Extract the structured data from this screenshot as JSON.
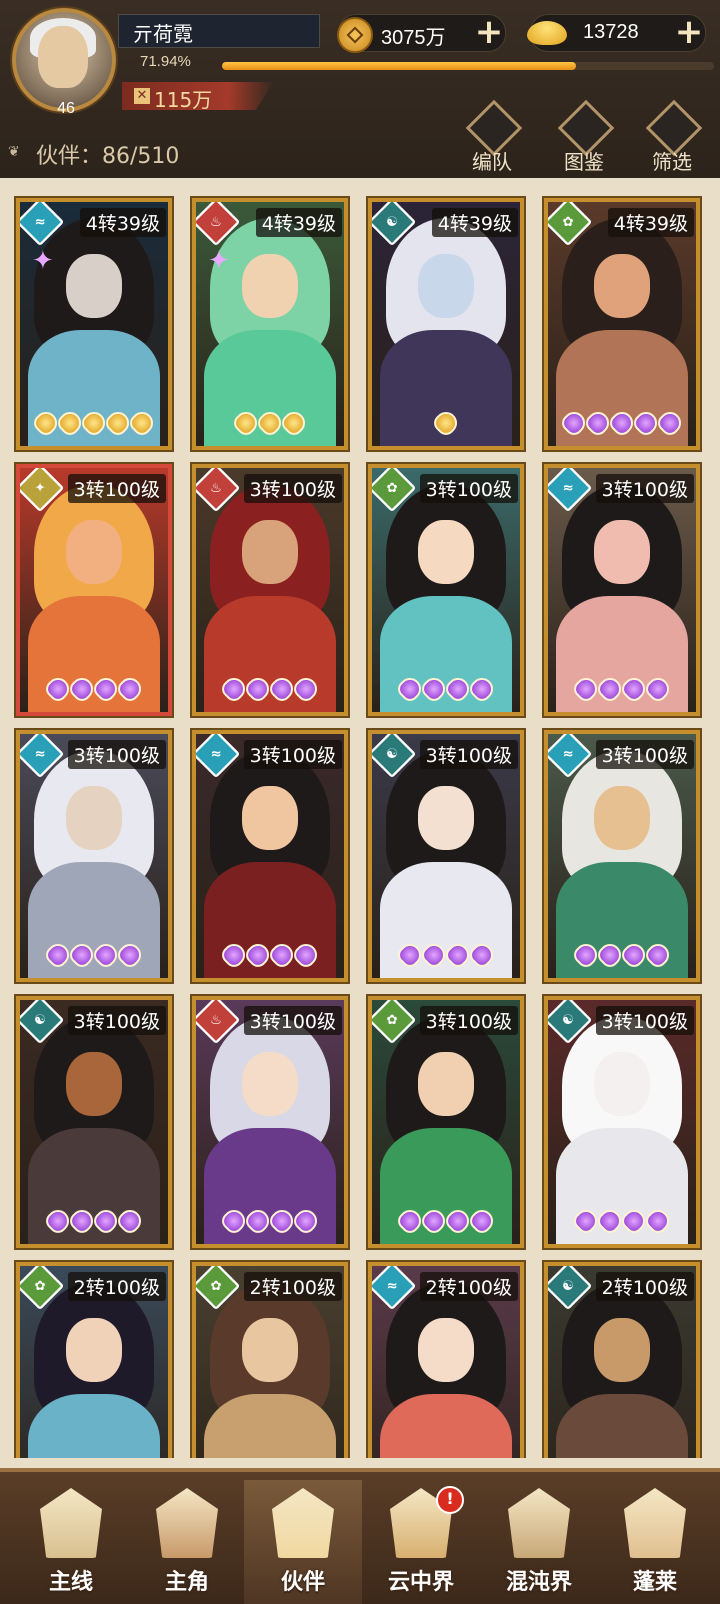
{
  "player": {
    "name": "亓荷霓",
    "level": "46",
    "exp_pct": "71.94%",
    "exp_fraction": 0.7194,
    "power": "115万"
  },
  "resources": {
    "coins": "3075万",
    "ingots": "13728"
  },
  "partners": {
    "label": "伙伴：86/510"
  },
  "toolbar": {
    "team": "编队",
    "codex": "图鉴",
    "filter": "筛选"
  },
  "cards": [
    {
      "tier": "4转39级",
      "element": "water",
      "stars": 5,
      "star_color": "gold",
      "sparkle": true
    },
    {
      "tier": "4转39级",
      "element": "fire",
      "stars": 3,
      "star_color": "gold",
      "sparkle": true
    },
    {
      "tier": "4转39级",
      "element": "dark",
      "stars": 1,
      "star_color": "gold",
      "sparkle": false
    },
    {
      "tier": "4转39级",
      "element": "wood",
      "stars": 5,
      "star_color": "purple",
      "sparkle": false
    },
    {
      "tier": "3转100级",
      "element": "earth",
      "stars": 4,
      "star_color": "purple",
      "sparkle": false
    },
    {
      "tier": "3转100级",
      "element": "fire",
      "stars": 4,
      "star_color": "purple",
      "sparkle": false
    },
    {
      "tier": "3转100级",
      "element": "wood",
      "stars": 4,
      "star_color": "purple",
      "sparkle": false
    },
    {
      "tier": "3转100级",
      "element": "water",
      "stars": 4,
      "star_color": "purple",
      "sparkle": false
    },
    {
      "tier": "3转100级",
      "element": "water",
      "stars": 4,
      "star_color": "purple",
      "sparkle": false
    },
    {
      "tier": "3转100级",
      "element": "water",
      "stars": 4,
      "star_color": "purple",
      "sparkle": false
    },
    {
      "tier": "3转100级",
      "element": "dark",
      "stars": 4,
      "star_color": "purple",
      "sparkle": false
    },
    {
      "tier": "3转100级",
      "element": "water",
      "stars": 4,
      "star_color": "purple",
      "sparkle": false
    },
    {
      "tier": "3转100级",
      "element": "dark",
      "stars": 4,
      "star_color": "purple",
      "sparkle": false
    },
    {
      "tier": "3转100级",
      "element": "fire",
      "stars": 4,
      "star_color": "purple",
      "sparkle": false
    },
    {
      "tier": "3转100级",
      "element": "wood",
      "stars": 4,
      "star_color": "purple",
      "sparkle": false
    },
    {
      "tier": "3转100级",
      "element": "dark",
      "stars": 4,
      "star_color": "purple",
      "sparkle": false
    },
    {
      "tier": "2转100级",
      "element": "wood",
      "stars": 0,
      "star_color": "purple",
      "sparkle": false
    },
    {
      "tier": "2转100级",
      "element": "wood",
      "stars": 0,
      "star_color": "purple",
      "sparkle": false
    },
    {
      "tier": "2转100级",
      "element": "water",
      "stars": 0,
      "star_color": "purple",
      "sparkle": false
    },
    {
      "tier": "2转100级",
      "element": "dark",
      "stars": 0,
      "star_color": "purple",
      "sparkle": false
    }
  ],
  "nav": [
    {
      "label": "主线",
      "active": false,
      "notify": false
    },
    {
      "label": "主角",
      "active": false,
      "notify": false
    },
    {
      "label": "伙伴",
      "active": true,
      "notify": false
    },
    {
      "label": "云中界",
      "active": false,
      "notify": true
    },
    {
      "label": "混沌界",
      "active": false,
      "notify": false
    },
    {
      "label": "蓬莱",
      "active": false,
      "notify": false
    }
  ],
  "colors": {
    "water": "#2aa0b8",
    "fire": "#c2403a",
    "dark": "#2a7a7a",
    "wood": "#5a9a3a",
    "earth": "#b9a23a",
    "frame_gold": "#c58f2e",
    "exp_fill": "#f0a31c"
  }
}
